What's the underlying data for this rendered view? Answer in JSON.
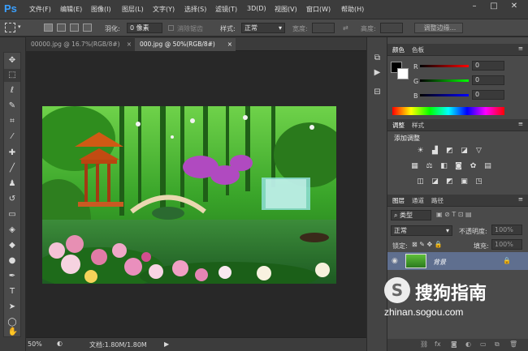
{
  "app": {
    "logo": "Ps"
  },
  "menu": [
    "文件(F)",
    "编辑(E)",
    "图像(I)",
    "图层(L)",
    "文字(Y)",
    "选择(S)",
    "滤镜(T)",
    "3D(D)",
    "视图(V)",
    "窗口(W)",
    "帮助(H)"
  ],
  "window_controls": {
    "minimize": "–",
    "restore": "□",
    "close": "✕"
  },
  "options": {
    "feather_label": "羽化:",
    "feather_value": "0 像素",
    "antialias_label": "消除锯齿",
    "style_label": "样式:",
    "style_value": "正常",
    "width_label": "宽度:",
    "height_label": "高度:",
    "refine_button": "调整边缘..."
  },
  "tabs": [
    {
      "label": "00000.jpg @ 16.7%(RGB/8#)",
      "close": "×"
    },
    {
      "label": "000.jpg @ 50%(RGB/8#)",
      "close": "×"
    }
  ],
  "status": {
    "zoom": "50%",
    "doc": "文档:1.80M/1.80M"
  },
  "color_panel": {
    "tabs": [
      "颜色",
      "色板"
    ],
    "r_label": "R",
    "g_label": "G",
    "b_label": "B",
    "r": "0",
    "g": "0",
    "b": "0"
  },
  "adjust_panel": {
    "tabs": [
      "调整",
      "样式"
    ],
    "title": "添加调整"
  },
  "layers_panel": {
    "tabs": [
      "图层",
      "通道",
      "路径"
    ],
    "kind_label": "类型",
    "blend_mode": "正常",
    "opacity_label": "不透明度:",
    "opacity_value": "100%",
    "lock_label": "锁定:",
    "fill_label": "填充:",
    "fill_value": "100%",
    "layer_name": "背景"
  },
  "watermark": {
    "brand": "搜狗指南",
    "url": "zhinan.sogou.com"
  },
  "colors": {
    "accent": "#3aa0ff",
    "selected_layer": "#5f6f8f"
  }
}
